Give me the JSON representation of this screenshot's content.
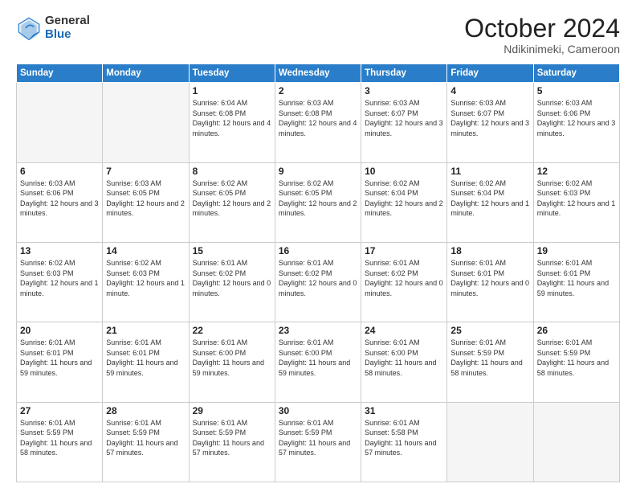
{
  "logo": {
    "general": "General",
    "blue": "Blue"
  },
  "title": "October 2024",
  "subtitle": "Ndikinimeki, Cameroon",
  "weekdays": [
    "Sunday",
    "Monday",
    "Tuesday",
    "Wednesday",
    "Thursday",
    "Friday",
    "Saturday"
  ],
  "days": [
    {
      "num": "",
      "empty": true
    },
    {
      "num": "",
      "empty": true
    },
    {
      "num": "1",
      "sunrise": "Sunrise: 6:04 AM",
      "sunset": "Sunset: 6:08 PM",
      "daylight": "Daylight: 12 hours and 4 minutes."
    },
    {
      "num": "2",
      "sunrise": "Sunrise: 6:03 AM",
      "sunset": "Sunset: 6:08 PM",
      "daylight": "Daylight: 12 hours and 4 minutes."
    },
    {
      "num": "3",
      "sunrise": "Sunrise: 6:03 AM",
      "sunset": "Sunset: 6:07 PM",
      "daylight": "Daylight: 12 hours and 3 minutes."
    },
    {
      "num": "4",
      "sunrise": "Sunrise: 6:03 AM",
      "sunset": "Sunset: 6:07 PM",
      "daylight": "Daylight: 12 hours and 3 minutes."
    },
    {
      "num": "5",
      "sunrise": "Sunrise: 6:03 AM",
      "sunset": "Sunset: 6:06 PM",
      "daylight": "Daylight: 12 hours and 3 minutes."
    },
    {
      "num": "6",
      "sunrise": "Sunrise: 6:03 AM",
      "sunset": "Sunset: 6:06 PM",
      "daylight": "Daylight: 12 hours and 3 minutes."
    },
    {
      "num": "7",
      "sunrise": "Sunrise: 6:03 AM",
      "sunset": "Sunset: 6:05 PM",
      "daylight": "Daylight: 12 hours and 2 minutes."
    },
    {
      "num": "8",
      "sunrise": "Sunrise: 6:02 AM",
      "sunset": "Sunset: 6:05 PM",
      "daylight": "Daylight: 12 hours and 2 minutes."
    },
    {
      "num": "9",
      "sunrise": "Sunrise: 6:02 AM",
      "sunset": "Sunset: 6:05 PM",
      "daylight": "Daylight: 12 hours and 2 minutes."
    },
    {
      "num": "10",
      "sunrise": "Sunrise: 6:02 AM",
      "sunset": "Sunset: 6:04 PM",
      "daylight": "Daylight: 12 hours and 2 minutes."
    },
    {
      "num": "11",
      "sunrise": "Sunrise: 6:02 AM",
      "sunset": "Sunset: 6:04 PM",
      "daylight": "Daylight: 12 hours and 1 minute."
    },
    {
      "num": "12",
      "sunrise": "Sunrise: 6:02 AM",
      "sunset": "Sunset: 6:03 PM",
      "daylight": "Daylight: 12 hours and 1 minute."
    },
    {
      "num": "13",
      "sunrise": "Sunrise: 6:02 AM",
      "sunset": "Sunset: 6:03 PM",
      "daylight": "Daylight: 12 hours and 1 minute."
    },
    {
      "num": "14",
      "sunrise": "Sunrise: 6:02 AM",
      "sunset": "Sunset: 6:03 PM",
      "daylight": "Daylight: 12 hours and 1 minute."
    },
    {
      "num": "15",
      "sunrise": "Sunrise: 6:01 AM",
      "sunset": "Sunset: 6:02 PM",
      "daylight": "Daylight: 12 hours and 0 minutes."
    },
    {
      "num": "16",
      "sunrise": "Sunrise: 6:01 AM",
      "sunset": "Sunset: 6:02 PM",
      "daylight": "Daylight: 12 hours and 0 minutes."
    },
    {
      "num": "17",
      "sunrise": "Sunrise: 6:01 AM",
      "sunset": "Sunset: 6:02 PM",
      "daylight": "Daylight: 12 hours and 0 minutes."
    },
    {
      "num": "18",
      "sunrise": "Sunrise: 6:01 AM",
      "sunset": "Sunset: 6:01 PM",
      "daylight": "Daylight: 12 hours and 0 minutes."
    },
    {
      "num": "19",
      "sunrise": "Sunrise: 6:01 AM",
      "sunset": "Sunset: 6:01 PM",
      "daylight": "Daylight: 11 hours and 59 minutes."
    },
    {
      "num": "20",
      "sunrise": "Sunrise: 6:01 AM",
      "sunset": "Sunset: 6:01 PM",
      "daylight": "Daylight: 11 hours and 59 minutes."
    },
    {
      "num": "21",
      "sunrise": "Sunrise: 6:01 AM",
      "sunset": "Sunset: 6:01 PM",
      "daylight": "Daylight: 11 hours and 59 minutes."
    },
    {
      "num": "22",
      "sunrise": "Sunrise: 6:01 AM",
      "sunset": "Sunset: 6:00 PM",
      "daylight": "Daylight: 11 hours and 59 minutes."
    },
    {
      "num": "23",
      "sunrise": "Sunrise: 6:01 AM",
      "sunset": "Sunset: 6:00 PM",
      "daylight": "Daylight: 11 hours and 59 minutes."
    },
    {
      "num": "24",
      "sunrise": "Sunrise: 6:01 AM",
      "sunset": "Sunset: 6:00 PM",
      "daylight": "Daylight: 11 hours and 58 minutes."
    },
    {
      "num": "25",
      "sunrise": "Sunrise: 6:01 AM",
      "sunset": "Sunset: 5:59 PM",
      "daylight": "Daylight: 11 hours and 58 minutes."
    },
    {
      "num": "26",
      "sunrise": "Sunrise: 6:01 AM",
      "sunset": "Sunset: 5:59 PM",
      "daylight": "Daylight: 11 hours and 58 minutes."
    },
    {
      "num": "27",
      "sunrise": "Sunrise: 6:01 AM",
      "sunset": "Sunset: 5:59 PM",
      "daylight": "Daylight: 11 hours and 58 minutes."
    },
    {
      "num": "28",
      "sunrise": "Sunrise: 6:01 AM",
      "sunset": "Sunset: 5:59 PM",
      "daylight": "Daylight: 11 hours and 57 minutes."
    },
    {
      "num": "29",
      "sunrise": "Sunrise: 6:01 AM",
      "sunset": "Sunset: 5:59 PM",
      "daylight": "Daylight: 11 hours and 57 minutes."
    },
    {
      "num": "30",
      "sunrise": "Sunrise: 6:01 AM",
      "sunset": "Sunset: 5:59 PM",
      "daylight": "Daylight: 11 hours and 57 minutes."
    },
    {
      "num": "31",
      "sunrise": "Sunrise: 6:01 AM",
      "sunset": "Sunset: 5:58 PM",
      "daylight": "Daylight: 11 hours and 57 minutes."
    },
    {
      "num": "",
      "empty": true
    },
    {
      "num": "",
      "empty": true
    }
  ]
}
